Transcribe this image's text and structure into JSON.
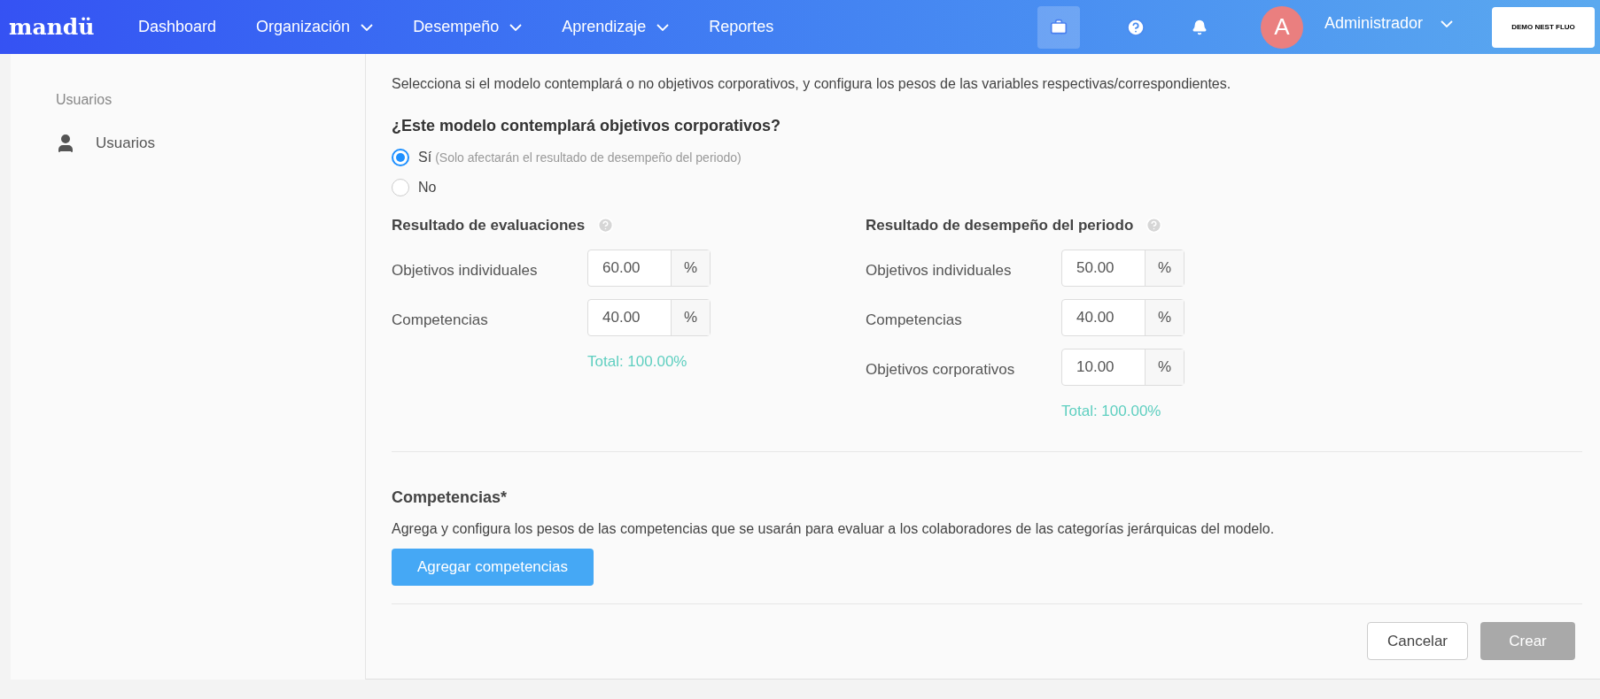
{
  "nav": {
    "logo": "mandü",
    "items": [
      {
        "label": "Dashboard",
        "dropdown": false
      },
      {
        "label": "Organización",
        "dropdown": true
      },
      {
        "label": "Desempeño",
        "dropdown": true
      },
      {
        "label": "Aprendizaje",
        "dropdown": true
      },
      {
        "label": "Reportes",
        "dropdown": false
      }
    ],
    "user": {
      "initial": "A",
      "name": "Administrador"
    },
    "company": "DEMO NEST FLUO"
  },
  "sidebar": {
    "section": "Usuarios",
    "items": [
      {
        "label": "Usuarios"
      }
    ]
  },
  "config": {
    "description": "Selecciona si el modelo contemplará o no objetivos corporativos, y configura los pesos de las variables respectivas/correspondientes.",
    "question": "¿Este modelo contemplará objetivos corporativos?",
    "options": [
      {
        "label": "Sí",
        "note": "(Solo afectarán el resultado de desempeño del periodo)",
        "selected": true
      },
      {
        "label": "No",
        "selected": false
      }
    ],
    "groups": [
      {
        "title": "Resultado de evaluaciones",
        "rows": [
          {
            "label": "Objetivos individuales",
            "value": "60.00",
            "unit": "%"
          },
          {
            "label": "Competencias",
            "value": "40.00",
            "unit": "%"
          }
        ],
        "total": "Total: 100.00%"
      },
      {
        "title": "Resultado de desempeño del periodo",
        "rows": [
          {
            "label": "Objetivos individuales",
            "value": "50.00",
            "unit": "%"
          },
          {
            "label": "Competencias",
            "value": "40.00",
            "unit": "%"
          },
          {
            "label": "Objetivos corporativos",
            "value": "10.00",
            "unit": "%"
          }
        ],
        "total": "Total: 100.00%"
      }
    ]
  },
  "competencias": {
    "title": "Competencias*",
    "description": "Agrega y configura los pesos de las competencias que se usarán para evaluar a los colaboradores de las categorías jerárquicas del modelo.",
    "button": "Agregar competencias"
  },
  "actions": [
    {
      "label": "Cancelar",
      "disabled": false
    },
    {
      "label": "Crear",
      "disabled": true
    }
  ]
}
